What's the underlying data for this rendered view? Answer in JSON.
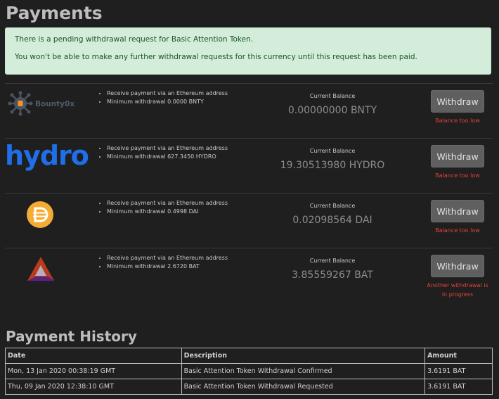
{
  "page_title": "Payments",
  "alert": {
    "line1": "There is a pending withdrawal request for Basic Attention Token.",
    "line2": "You won't be able to make any further withdrawal requests for this currency until this request has been paid."
  },
  "currencies": [
    {
      "logo_text": "Bounty0x",
      "features": [
        "Receive payment via an Ethereum address",
        "Minimum withdrawal 0.0000 BNTY"
      ],
      "balance_label": "Current Balance",
      "balance": "0.00000000 BNTY",
      "button": "Withdraw",
      "error": "Balance too low"
    },
    {
      "logo_text": "hydro",
      "features": [
        "Receive payment via an Ethereum address",
        "Minimum withdrawal 627.3450 HYDRO"
      ],
      "balance_label": "Current Balance",
      "balance": "19.30513980 HYDRO",
      "button": "Withdraw",
      "error": "Balance too low"
    },
    {
      "logo_text": "",
      "features": [
        "Receive payment via an Ethereum address",
        "Minimum withdrawal 0.4998 DAI"
      ],
      "balance_label": "Current Balance",
      "balance": "0.02098564 DAI",
      "button": "Withdraw",
      "error": "Balance too low"
    },
    {
      "logo_text": "",
      "features": [
        "Receive payment via an Ethereum address",
        "Minimum withdrawal 2.6720 BAT"
      ],
      "balance_label": "Current Balance",
      "balance": "3.85559267 BAT",
      "button": "Withdraw",
      "error": "Another withdrawal is in progress"
    }
  ],
  "colors": {
    "bounty_orange": "#f7931a",
    "bounty_gray": "#4a5563",
    "hydro_blue": "#1f6feb",
    "dai_orange": "#f5ac37",
    "bat_orange": "#ff5000",
    "bat_purple": "#662d91",
    "error_red": "#e0443a"
  },
  "history": {
    "title": "Payment History",
    "columns": [
      "Date",
      "Description",
      "Amount"
    ],
    "rows": [
      [
        "Mon, 13 Jan 2020 00:38:19 GMT",
        "Basic Attention Token Withdrawal Confirmed",
        "3.6191 BAT"
      ],
      [
        "Thu, 09 Jan 2020 12:38:10 GMT",
        "Basic Attention Token Withdrawal Requested",
        "3.6191 BAT"
      ]
    ]
  }
}
